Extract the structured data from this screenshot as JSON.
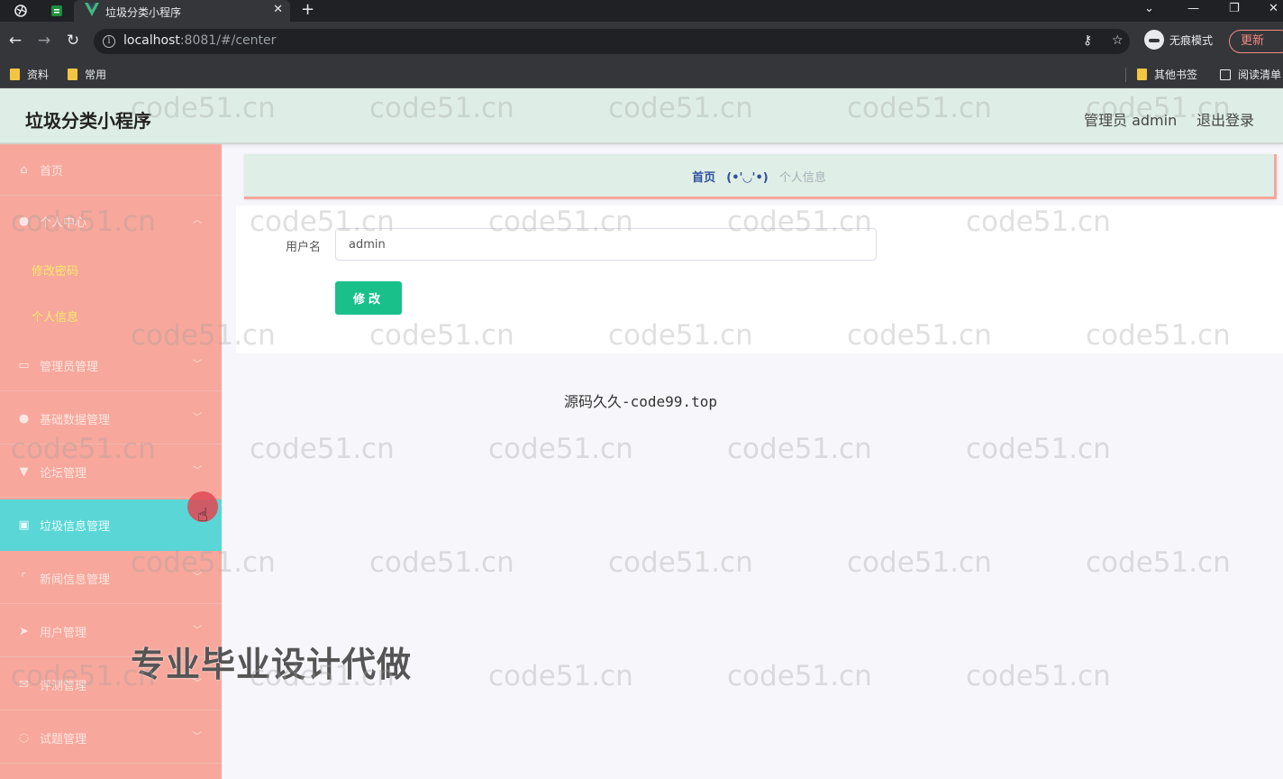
{
  "browser": {
    "tab_title": "垃圾分类小程序",
    "url_host": "localhost",
    "url_rest": ":8081/#/center",
    "incognito_label": "无痕模式",
    "update_label": "更新",
    "bookmarks": [
      "资料",
      "常用"
    ],
    "bookmarks_right": [
      "其他书签",
      "阅读清单"
    ]
  },
  "header": {
    "title": "垃圾分类小程序",
    "user": "管理员 admin",
    "logout": "退出登录"
  },
  "sidebar": {
    "items": [
      {
        "label": "首页",
        "icon": "home-icon"
      },
      {
        "label": "个人中心",
        "icon": "user-icon"
      },
      {
        "label": "管理员管理",
        "icon": "id-card-icon"
      },
      {
        "label": "基础数据管理",
        "icon": "user-icon"
      },
      {
        "label": "论坛管理",
        "icon": "thumb-icon"
      },
      {
        "label": "垃圾信息管理",
        "icon": "clipboard-icon"
      },
      {
        "label": "新闻信息管理",
        "icon": "frame-icon"
      },
      {
        "label": "用户管理",
        "icon": "send-icon"
      },
      {
        "label": "评测管理",
        "icon": "mail-icon"
      },
      {
        "label": "试题管理",
        "icon": "globe-icon"
      }
    ],
    "submenu": [
      "修改密码",
      "个人信息"
    ]
  },
  "breadcrumb": {
    "home": "首页",
    "separator": "(•'◡'•)",
    "current": "个人信息"
  },
  "form": {
    "username_label": "用户名",
    "username_value": "admin",
    "submit_label": "修改"
  },
  "footer_text": "源码久久-code99.top",
  "promo_text": "专业毕业设计代做",
  "watermark_text": "code51.cn",
  "colors": {
    "sidebar_bg": "#f7a79b",
    "sidebar_active": "#5ad6d6",
    "header_bg": "#deeee6",
    "submenu_text": "#f7ea6a",
    "button": "#19c08a",
    "breadcrumb_home": "#2f4f9e"
  }
}
